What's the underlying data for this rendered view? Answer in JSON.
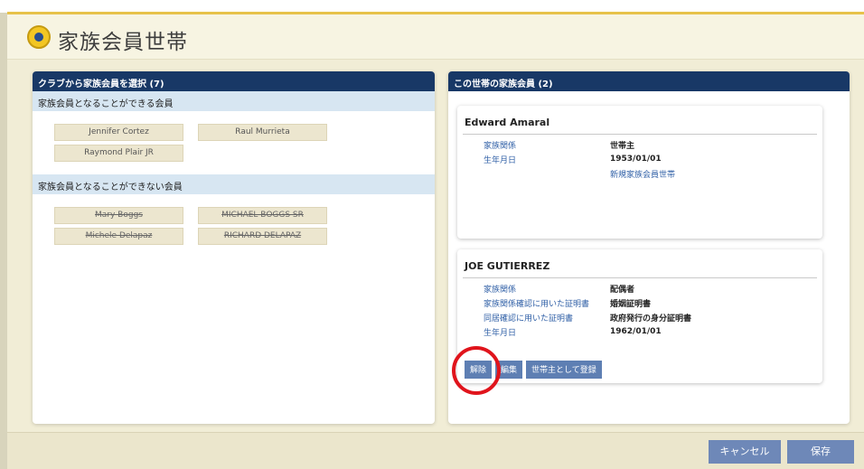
{
  "header": {
    "title": "家族会員世帯"
  },
  "left_panel": {
    "title": "クラブから家族会員を選択 (7)",
    "eligible": {
      "heading": "家族会員となることができる会員",
      "members": [
        "Jennifer Cortez",
        "Raul Murrieta",
        "Raymond Plair JR"
      ]
    },
    "ineligible": {
      "heading": "家族会員となることができない会員",
      "members": [
        "Mary Boggs",
        "MICHAEL BOGGS SR",
        "Michele Delapaz",
        "RICHARD DELAPAZ"
      ]
    }
  },
  "right_panel": {
    "title": "この世帯の家族会員 (2)",
    "members": [
      {
        "name": "Edward  Amaral",
        "rows": [
          {
            "label": "家族関係",
            "value": "世帯主"
          },
          {
            "label": "生年月日",
            "value": "1953/01/01"
          }
        ],
        "note": "新規家族会員世帯"
      },
      {
        "name": "JOE  GUTIERREZ",
        "rows": [
          {
            "label": "家族関係",
            "value": "配偶者"
          },
          {
            "label": "家族関係確認に用いた証明書",
            "value": "婚姻証明書"
          },
          {
            "label": "同居確認に用いた証明書",
            "value": "政府発行の身分証明書"
          },
          {
            "label": "生年月日",
            "value": "1962/01/01"
          }
        ],
        "buttons": {
          "remove": "解除",
          "edit": "編集",
          "set_head": "世帯主として登録"
        }
      }
    ]
  },
  "footer": {
    "cancel": "キャンセル",
    "save": "保存"
  },
  "colors": {
    "navy": "#183866",
    "button_blue": "#5e7fb3",
    "highlight_red": "#e0141c",
    "gold": "#e7c24a"
  }
}
